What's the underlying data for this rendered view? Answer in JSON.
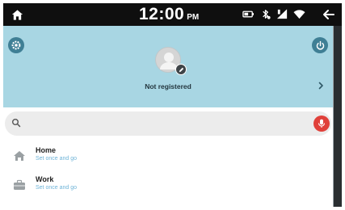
{
  "status_bar": {
    "time": "12:00",
    "ampm": "PM",
    "icons": [
      "home-icon",
      "battery-icon",
      "bluetooth-icon",
      "signal-icon",
      "wifi-icon",
      "back-arrow-icon"
    ]
  },
  "profile": {
    "status": "Not registered",
    "icons": [
      "settings-icon",
      "power-icon",
      "avatar-icon",
      "chevron-right-icon"
    ],
    "background_color": "#a8d6e3"
  },
  "search": {
    "placeholder": "",
    "value": "",
    "icons": [
      "search-icon",
      "microphone-icon"
    ],
    "mic_color": "#e0403a"
  },
  "places": [
    {
      "title": "Home",
      "subtitle": "Set once and go",
      "icon": "home-icon"
    },
    {
      "title": "Work",
      "subtitle": "Set once and go",
      "icon": "work-icon"
    }
  ],
  "colors": {
    "accent": "#3f7f95",
    "link": "#6fb4d8"
  }
}
